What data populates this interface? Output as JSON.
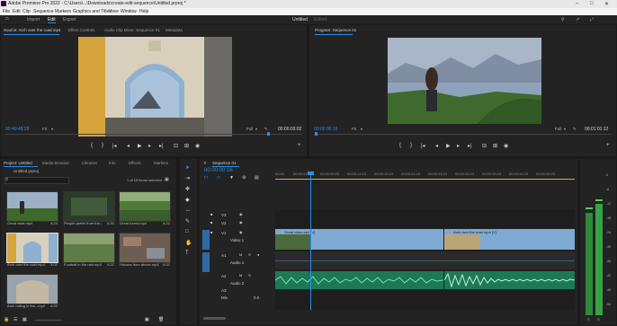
{
  "window": {
    "title": "Adobe Premiere Pro 2022 - C:\\Users\\...\\Downloads\\create-edit-sequence\\Untitled.prproj *"
  },
  "menu": [
    "File",
    "Edit",
    "Clip",
    "Sequence",
    "Markers",
    "Graphics and Titles",
    "View",
    "Window",
    "Help"
  ],
  "workspace": {
    "tabs": [
      "Import",
      "Edit",
      "Export"
    ],
    "active": "Edit",
    "center": "Untitled",
    "center_suffix": "Edited"
  },
  "source_panel": {
    "tabs": [
      "Source: Arch over the road.mp4",
      "Effect Controls",
      "Audio Clip Mixer: Sequence 01",
      "Metadata"
    ],
    "timecode": "00:40:48:28",
    "fit": "Fit",
    "quality": "Full",
    "duration": "00:00:03:02"
  },
  "program_panel": {
    "tab": "Program: Sequence 01",
    "timecode": "00:00:00:16",
    "fit": "Fit",
    "quality": "Full",
    "duration": "00:01:01:12"
  },
  "project_panel": {
    "tabs": [
      "Project: Untitled",
      "Media Browser",
      "Libraries",
      "Info",
      "Effects",
      "Markers"
    ],
    "bin": "Untitled.prproj",
    "selection": "1 of 15 items selected",
    "items": [
      {
        "name": "Great vista.mp4",
        "dur": "4:23"
      },
      {
        "name": "People prefer from the...",
        "dur": "4:20"
      },
      {
        "name": "Great forest.mp4",
        "dur": "4:22"
      },
      {
        "name": "Arch over the road.mp4",
        "dur": "3:02"
      },
      {
        "name": "Football in the rain.mp4",
        "dur": "4:22"
      },
      {
        "name": "Houses from above.mp4",
        "dur": "4:22"
      },
      {
        "name": "Arch rolling in the...mp4",
        "dur": "4:22"
      }
    ]
  },
  "timeline": {
    "tab": "Sequence 01",
    "timecode": "00:00:00:16",
    "ruler": [
      "00:00",
      "00:00:04:23",
      "00:00:09:23",
      "00:00:14:23",
      "00:00:19:23",
      "00:00:24:23",
      "00:00:29:23",
      "00:00:34:23",
      "00:00:39:23",
      "00:00:44:23",
      "00:00:49:23"
    ],
    "tracks": {
      "video": [
        "V3",
        "V2",
        "V1"
      ],
      "audio": [
        "A1",
        "A2",
        "A3"
      ],
      "v1_label": "Video 1",
      "a1_label": "Audio 1",
      "a2_label": "Audio 2",
      "mix": "Mix",
      "mix_value": "0.0"
    },
    "clips": [
      {
        "name": "Great vista.mp4 [V]"
      },
      {
        "name": "Arch over the road.mp4 [V]"
      }
    ]
  },
  "audio_meter": {
    "scale": [
      "0",
      "-6",
      "-12",
      "-18",
      "-24",
      "-30",
      "-36",
      "-42",
      "-48",
      "-54"
    ],
    "bottom": [
      "S",
      "S"
    ]
  },
  "colors": {
    "accent": "#2d8ceb",
    "video_clip": "#7ea9d3",
    "audio_clip": "#1b7a55",
    "playhead": "#2d8ceb"
  }
}
